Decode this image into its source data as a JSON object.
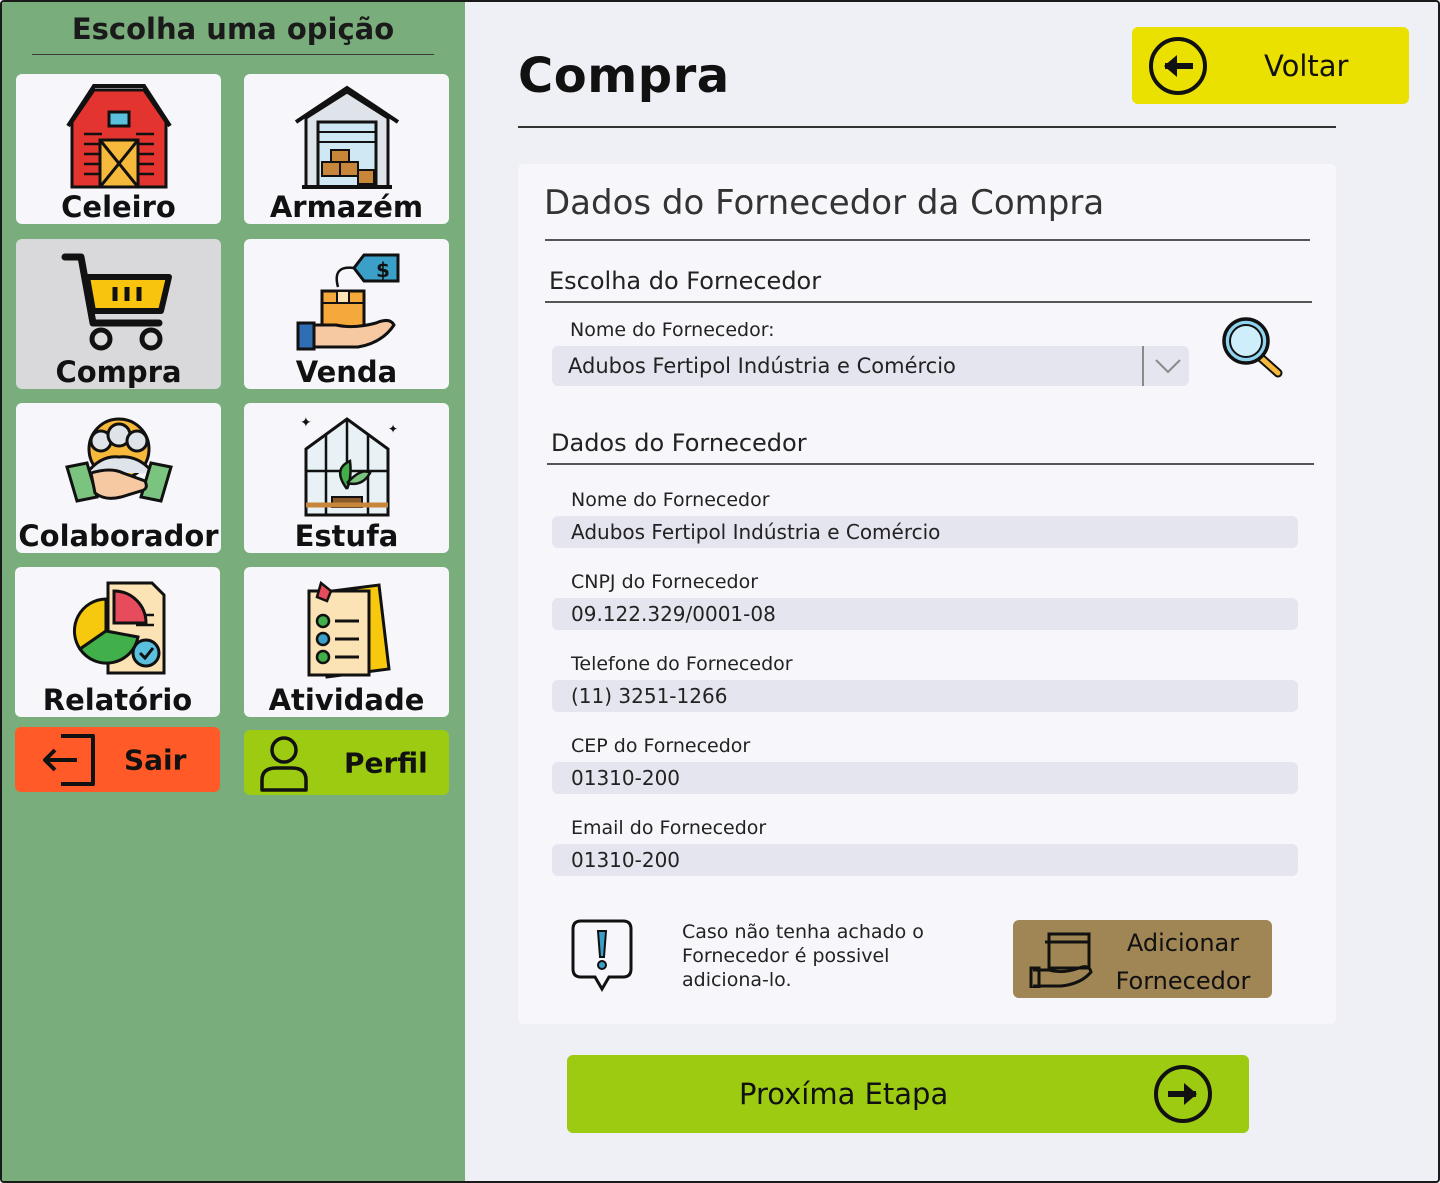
{
  "sidebar": {
    "title": "Escolha uma opição",
    "tiles": {
      "celeiro": "Celeiro",
      "armazem": "Armazém",
      "compra": "Compra",
      "venda": "Venda",
      "colaborador": "Colaborador",
      "estufa": "Estufa",
      "relatorio": "Relatório",
      "atividade": "Atividade"
    },
    "active": "compra",
    "sair_label": "Sair",
    "perfil_label": "Perfil"
  },
  "header": {
    "title": "Compra",
    "back_label": "Voltar"
  },
  "card": {
    "title": "Dados do Fornecedor da Compra",
    "choose_section": "Escolha do Fornecedor",
    "select_label": "Nome do Fornecedor:",
    "select_value": "Adubos Fertipol Indústria e Comércio",
    "data_section": "Dados do Fornecedor",
    "fields": [
      {
        "label": "Nome do Fornecedor",
        "value": "Adubos Fertipol Indústria e Comércio"
      },
      {
        "label": "CNPJ do Fornecedor",
        "value": "09.122.329/0001-08"
      },
      {
        "label": "Telefone do Fornecedor",
        "value": "(11) 3251-1266"
      },
      {
        "label": "CEP do Fornecedor",
        "value": "01310-200"
      },
      {
        "label": "Email do Fornecedor",
        "value": "01310-200"
      }
    ],
    "info_line1": "Caso não tenha achado o",
    "info_line2": "Fornecedor é possivel",
    "info_line3": "adiciona-lo.",
    "add_line1": "Adicionar",
    "add_line2": "Fornecedor"
  },
  "next_label": "Proxíma Etapa",
  "colors": {
    "sidebar": "#79ad7b",
    "voltar": "#ebe100",
    "sair": "#ff5a27",
    "perfil": "#9ccb12",
    "next": "#9ccb12",
    "add": "#a08654"
  }
}
